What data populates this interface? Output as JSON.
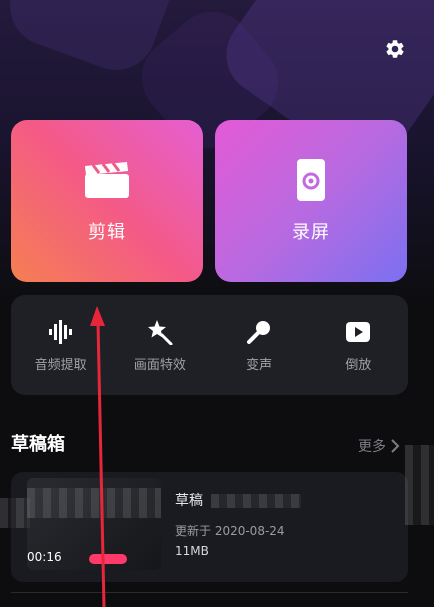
{
  "colors": {
    "background": "#0d0d10",
    "edit_tile_gradient": [
      "#f57f52",
      "#f45a86",
      "#e55fd2"
    ],
    "record_tile_gradient": [
      "#e35ad6",
      "#b96ae0",
      "#7b70f0"
    ],
    "tool_panel": "#1f2025",
    "annotation_arrow": "#e8263a",
    "duration_badge": "#ff3a6a"
  },
  "header": {
    "settings_icon": "gear-icon"
  },
  "tiles": {
    "edit": {
      "label": "剪辑",
      "icon": "clapperboard-icon"
    },
    "record": {
      "label": "录屏",
      "icon": "screen-record-icon"
    }
  },
  "tools": [
    {
      "label": "音频提取",
      "icon": "audio-wave-icon"
    },
    {
      "label": "画面特效",
      "icon": "magic-star-icon"
    },
    {
      "label": "变声",
      "icon": "microphone-icon"
    },
    {
      "label": "倒放",
      "icon": "play-box-icon"
    }
  ],
  "drafts": {
    "title": "草稿箱",
    "more_label": "更多",
    "items": [
      {
        "title": "草稿",
        "updated": "更新于 2020-08-24",
        "size": "11MB",
        "duration": "00:16"
      }
    ]
  }
}
